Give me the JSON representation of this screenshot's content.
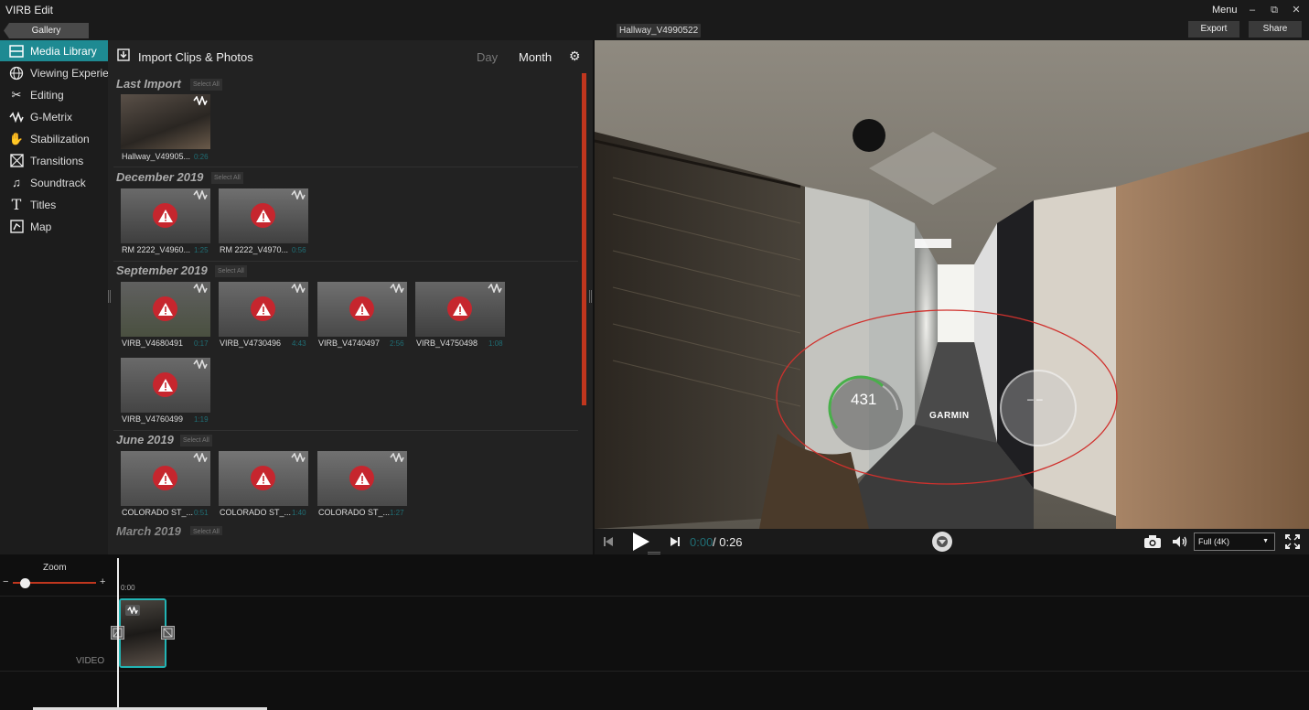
{
  "app": {
    "title": "VIRB Edit",
    "menu_label": "Menu",
    "minimize": "–",
    "maximize": "⧉",
    "close": "✕"
  },
  "toolbar": {
    "gallery": "Gallery",
    "filename": "Hallway_V4990522",
    "export": "Export",
    "share": "Share"
  },
  "sidebar": {
    "items": [
      {
        "label": "Media Library",
        "icon": "film-icon"
      },
      {
        "label": "Viewing Experience",
        "icon": "globe-icon"
      },
      {
        "label": "Editing",
        "icon": "scissors-icon"
      },
      {
        "label": "G-Metrix",
        "icon": "gmetrix-icon"
      },
      {
        "label": "Stabilization",
        "icon": "hand-icon"
      },
      {
        "label": "Transitions",
        "icon": "transition-icon"
      },
      {
        "label": "Soundtrack",
        "icon": "music-note-icon"
      },
      {
        "label": "Titles",
        "icon": "title-t-icon"
      },
      {
        "label": "Map",
        "icon": "map-icon"
      }
    ]
  },
  "library": {
    "import_label": "Import Clips & Photos",
    "tabs": {
      "day": "Day",
      "month": "Month"
    },
    "select_all": "Select All",
    "sections": [
      {
        "title": "Last Import",
        "clips": [
          {
            "name": "Hallway_V49905...",
            "duration": "0:26"
          }
        ]
      },
      {
        "title": "December 2019",
        "clips": [
          {
            "name": "RM 2222_V4960...",
            "duration": "1:25"
          },
          {
            "name": "RM 2222_V4970...",
            "duration": "0:56"
          }
        ]
      },
      {
        "title": "September 2019",
        "clips": [
          {
            "name": "VIRB_V4680491",
            "duration": "0:17"
          },
          {
            "name": "VIRB_V4730496",
            "duration": "4:43"
          },
          {
            "name": "VIRB_V4740497",
            "duration": "2:56"
          },
          {
            "name": "VIRB_V4750498",
            "duration": "1:08"
          },
          {
            "name": "VIRB_V4760499",
            "duration": "1:19"
          }
        ]
      },
      {
        "title": "June 2019",
        "clips": [
          {
            "name": "COLORADO ST_...",
            "duration": "0:51"
          },
          {
            "name": "COLORADO ST_...",
            "duration": "1:40"
          },
          {
            "name": "COLORADO ST_...",
            "duration": "1:27"
          }
        ]
      },
      {
        "title": "March 2019"
      }
    ]
  },
  "player": {
    "time_current": "0:00",
    "time_total": "/ 0:26",
    "quality": "Full (4K)",
    "overlay": {
      "speed_value": "431",
      "brand": "GARMIN",
      "gauge_right": "– –"
    }
  },
  "timeline": {
    "zoom_label": "Zoom",
    "zoom_minus": "−",
    "zoom_plus": "+",
    "zoom_level": 0.15,
    "time_zero": "0:00",
    "track_label": "VIDEO"
  },
  "colors": {
    "accent": "#1e8a92",
    "scrollbar": "#c0361e",
    "warning": "#c6262e",
    "annotation": "#d0312d"
  }
}
